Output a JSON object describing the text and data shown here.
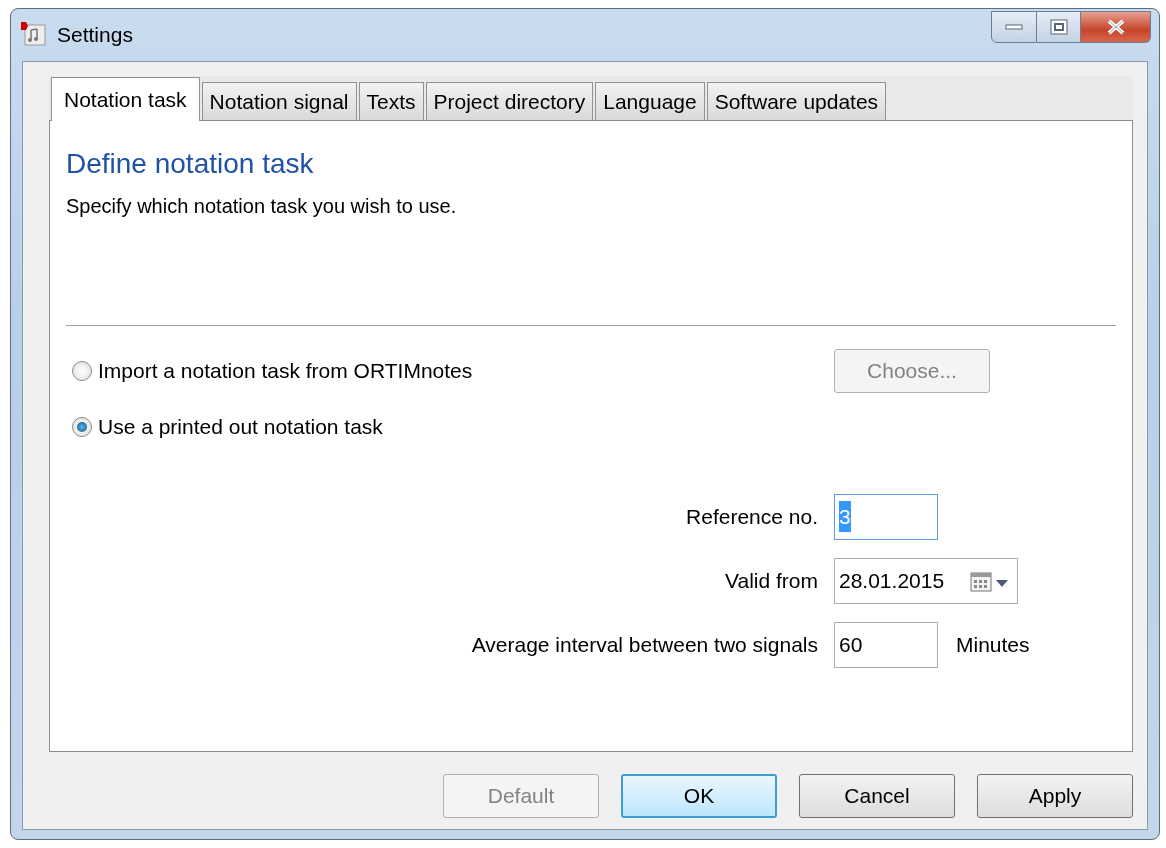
{
  "window": {
    "title": "Settings"
  },
  "tabs": [
    {
      "label": "Notation task",
      "selected": true
    },
    {
      "label": "Notation signal",
      "selected": false
    },
    {
      "label": "Texts",
      "selected": false
    },
    {
      "label": "Project directory",
      "selected": false
    },
    {
      "label": "Language",
      "selected": false
    },
    {
      "label": "Software updates",
      "selected": false
    }
  ],
  "heading": "Define notation task",
  "description": "Specify which notation task you wish to use.",
  "options": [
    {
      "label": "Import a notation task from ORTIMnotes",
      "selected": false,
      "button": {
        "label": "Choose...",
        "disabled": true
      }
    },
    {
      "label": "Use a printed out notation task",
      "selected": true
    }
  ],
  "fields": [
    {
      "kind": "text",
      "label": "Reference no.",
      "value": "3",
      "value_selected": true
    },
    {
      "kind": "date",
      "label": "Valid from",
      "value": "28.01.2015"
    },
    {
      "kind": "text",
      "label": "Average interval between two signals",
      "value": "60",
      "suffix": "Minutes"
    }
  ],
  "buttons": [
    {
      "label": "Default",
      "disabled": true,
      "default": false
    },
    {
      "label": "OK",
      "disabled": false,
      "default": true
    },
    {
      "label": "Cancel",
      "disabled": false,
      "default": false
    },
    {
      "label": "Apply",
      "disabled": false,
      "default": false
    }
  ]
}
